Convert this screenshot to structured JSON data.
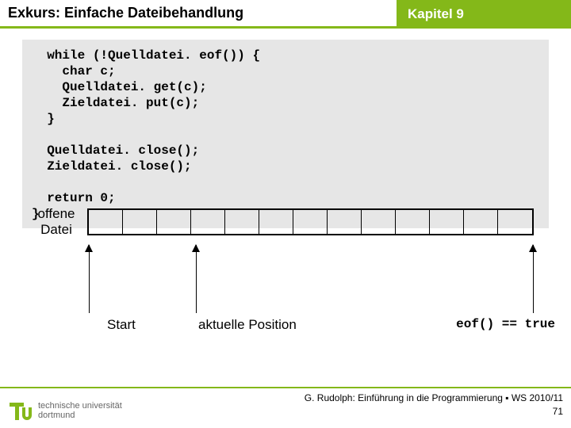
{
  "header": {
    "title": "Exkurs: Einfache Dateibehandlung",
    "chapter": "Kapitel 9"
  },
  "code": "  while (!Quelldatei. eof()) {\n    char c;\n    Quelldatei. get(c);\n    Zieldatei. put(c);\n  }\n\n  Quelldatei. close();\n  Zieldatei. close();\n\n  return 0;\n}",
  "diagram": {
    "label": "offene Datei",
    "cell_count": 13,
    "labels": {
      "start": "Start",
      "current": "aktuelle Position",
      "eof": "eof() == true"
    }
  },
  "footer": {
    "credit": "G. Rudolph: Einführung in die Programmierung ▪ WS 2010/11",
    "page": "71",
    "uni": "technische universität\ndortmund"
  }
}
